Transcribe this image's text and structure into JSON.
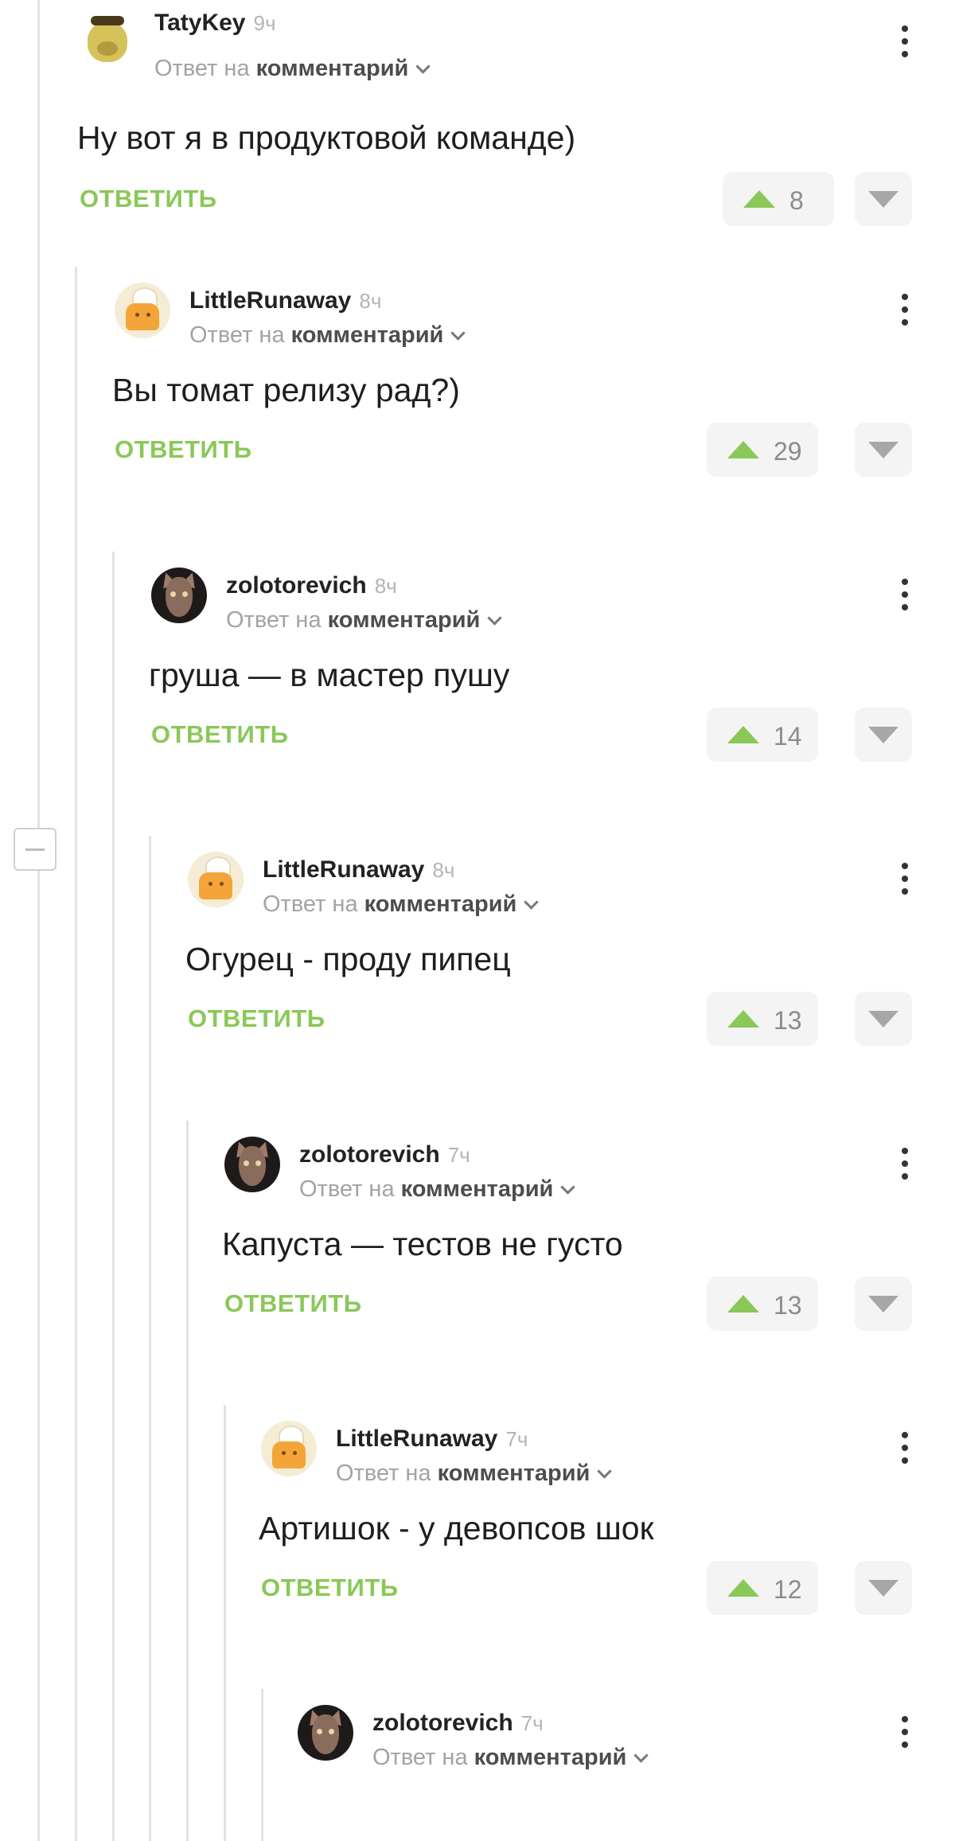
{
  "comments": [
    {
      "user": "TatyKey",
      "time": "9ч",
      "reply_prefix": "Ответ на",
      "reply_target": "комментарий",
      "text": "Ну вот я в продуктовой команде)",
      "reply_label": "ОТВЕТИТЬ",
      "votes": "8",
      "avatar": "yellow-dog-with-sunglasses"
    },
    {
      "user": "LittleRunaway",
      "time": "8ч",
      "reply_prefix": "Ответ на",
      "reply_target": "комментарий",
      "text": "Вы томат релизу рад?)",
      "reply_label": "ОТВЕТИТЬ",
      "votes": "29",
      "avatar": "chef-character"
    },
    {
      "user": "zolotorevich",
      "time": "8ч",
      "reply_prefix": "Ответ на",
      "reply_target": "комментарий",
      "text": "груша — в мастер пушу",
      "reply_label": "ОТВЕТИТЬ",
      "votes": "14",
      "avatar": "sphynx-cat"
    },
    {
      "user": "LittleRunaway",
      "time": "8ч",
      "reply_prefix": "Ответ на",
      "reply_target": "комментарий",
      "text": "Огурец - проду пипец",
      "reply_label": "ОТВЕТИТЬ",
      "votes": "13",
      "avatar": "chef-character"
    },
    {
      "user": "zolotorevich",
      "time": "7ч",
      "reply_prefix": "Ответ на",
      "reply_target": "комментарий",
      "text": "Капуста — тестов не густо",
      "reply_label": "ОТВЕТИТЬ",
      "votes": "13",
      "avatar": "sphynx-cat"
    },
    {
      "user": "LittleRunaway",
      "time": "7ч",
      "reply_prefix": "Ответ на",
      "reply_target": "комментарий",
      "text": "Артишок - у девопсов шок",
      "reply_label": "ОТВЕТИТЬ",
      "votes": "12",
      "avatar": "chef-character"
    },
    {
      "user": "zolotorevich",
      "time": "7ч",
      "reply_prefix": "Ответ на",
      "reply_target": "комментарий",
      "text": "",
      "reply_label": "",
      "votes": "",
      "avatar": "sphynx-cat"
    }
  ],
  "colors": {
    "accent": "#8ac858",
    "muted": "#a3a3a3",
    "thread_line": "#e2e2e2"
  },
  "icons": {
    "upvote": "triangle-up-icon",
    "downvote": "triangle-down-icon",
    "more": "kebab-menu-icon",
    "collapse": "minus-square-icon",
    "reply_dropdown": "chevron-down-icon"
  }
}
